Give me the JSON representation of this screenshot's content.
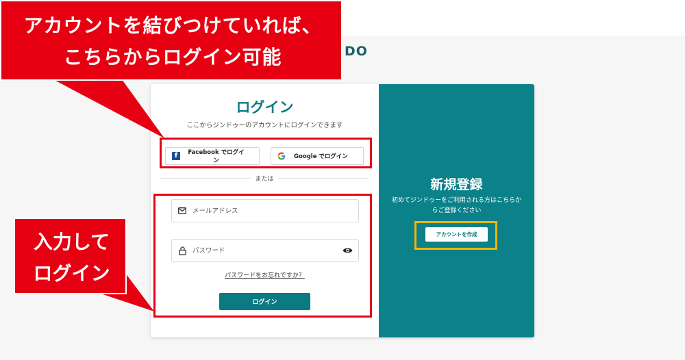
{
  "header": {
    "logo_partial": "DO"
  },
  "login": {
    "title": "ログイン",
    "subtitle": "ここからジンドゥーのアカウントにログインできます",
    "facebook_label": "Facebook でログイン",
    "google_label": "Google でログイン",
    "or_label": "または",
    "email_placeholder": "メールアドレス",
    "password_placeholder": "パスワード",
    "forgot_label": "パスワードをお忘れですか？",
    "submit_label": "ログイン"
  },
  "register": {
    "title": "新規登録",
    "description": "初めてジンドゥーをご利用される方はこちらからご登録ください",
    "create_label": "アカウントを作成"
  },
  "annotations": {
    "top_line1": "アカウントを結びつけていれば、",
    "top_line2": "こちらからログイン可能",
    "bottom_line1": "入力して",
    "bottom_line2": "ログイン"
  },
  "colors": {
    "brand_teal": "#0b8189",
    "annotation_red": "#e60012",
    "highlight_yellow": "#f5b400"
  },
  "icons": [
    "facebook-icon",
    "google-icon",
    "mail-icon",
    "lock-icon",
    "eye-icon"
  ]
}
